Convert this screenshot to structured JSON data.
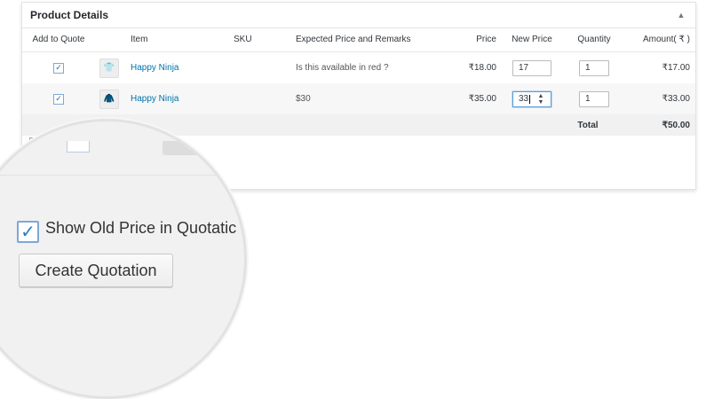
{
  "panel": {
    "title": "Product Details",
    "collapse_icon": "triangle-up-icon"
  },
  "table": {
    "columns": {
      "add": "Add to Quote",
      "item": "Item",
      "sku": "SKU",
      "expected": "Expected Price and Remarks",
      "price": "Price",
      "new_price": "New Price",
      "quantity": "Quantity",
      "amount": "Amount( ₹ )"
    },
    "rows": [
      {
        "checked": true,
        "thumbnail_icon": "tshirt-thumbnail",
        "item": "Happy Ninja",
        "sku": "",
        "remarks": "Is this available in red ?",
        "price": "₹18.00",
        "new_price": "17",
        "quantity": "1",
        "amount": "₹17.00"
      },
      {
        "checked": true,
        "thumbnail_icon": "hoodie-thumbnail",
        "item": "Happy Ninja",
        "sku": "",
        "remarks": "$30",
        "price": "₹35.00",
        "new_price": "33",
        "quantity": "1",
        "amount": "₹33.00"
      }
    ],
    "total": {
      "label": "Total",
      "amount": "₹50.00"
    }
  },
  "partial": {
    "show_old_price_fragment": "Sh"
  },
  "magnifier": {
    "show_old_price_label": "Show Old Price in Quotatic",
    "show_old_price_checked": true,
    "create_button_label": "Create Quotation"
  },
  "colors": {
    "link": "#0073aa",
    "checkbox_border": "#7ea9d6",
    "focus": "#5b9dd9"
  }
}
